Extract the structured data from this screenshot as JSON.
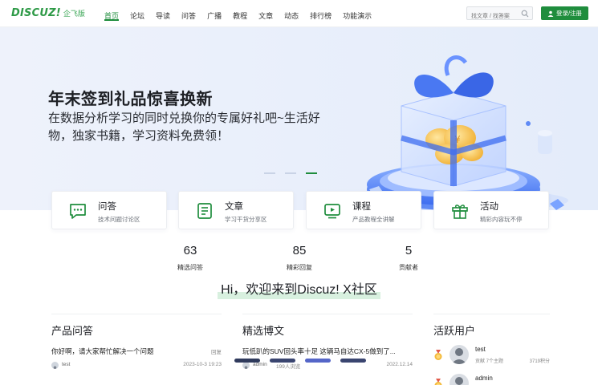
{
  "brand": {
    "logo_text": "DISCUZ!",
    "edition": "企飞版",
    "accent": "#1f8d3d"
  },
  "nav": {
    "items": [
      {
        "label": "首页",
        "active": true
      },
      {
        "label": "论坛"
      },
      {
        "label": "导读"
      },
      {
        "label": "问答"
      },
      {
        "label": "广播"
      },
      {
        "label": "教程"
      },
      {
        "label": "文章"
      },
      {
        "label": "动态"
      },
      {
        "label": "排行榜"
      },
      {
        "label": "功能演示"
      }
    ]
  },
  "search": {
    "placeholder": "找文章 / 找答案",
    "icon": "search-icon"
  },
  "login": {
    "label": "登录/注册",
    "icon": "user-icon"
  },
  "hero": {
    "title": "年末签到礼品惊喜换新",
    "text": "在数据分析学习的同时兑换你的专属好礼吧~生活好物，独家书籍，学习资料免费领！",
    "slide_count": 3,
    "active_slide": 3
  },
  "cards": [
    {
      "title": "问答",
      "subtitle": "技术问题讨论区",
      "icon": "chat-icon"
    },
    {
      "title": "文章",
      "subtitle": "学习干货分享区",
      "icon": "document-icon"
    },
    {
      "title": "课程",
      "subtitle": "产品教程全讲解",
      "icon": "video-icon"
    },
    {
      "title": "活动",
      "subtitle": "精彩内容玩不停",
      "icon": "gift-icon"
    }
  ],
  "stats": [
    {
      "value": "63",
      "label": "精选问答"
    },
    {
      "value": "85",
      "label": "精彩回复"
    },
    {
      "value": "5",
      "label": "贡献者"
    }
  ],
  "welcome": "Hi，欢迎来到Discuz! X社区",
  "qa": {
    "title": "产品问答",
    "item": {
      "title": "你好啊，请大家帮忙解决一个问题",
      "tag": "回复",
      "user": "test",
      "date": "2023-10-3 19:23"
    }
  },
  "blog": {
    "title": "精选博文",
    "item": {
      "title": "玩低趴的SUV回头率十足 这辆马自达CX-5做到了...",
      "user": "admin",
      "views": "199人浏览",
      "date": "2022.12.14"
    }
  },
  "users": {
    "title": "活跃用户",
    "items": [
      {
        "name": "test",
        "sub": "贡献 7个主题",
        "score": "3719积分"
      },
      {
        "name": "admin",
        "sub": "",
        "score": ""
      }
    ]
  },
  "colors": {
    "primary": "#1f8d3d",
    "hero_bg": "#eaf0fb",
    "highlight": "#d8f0df"
  }
}
